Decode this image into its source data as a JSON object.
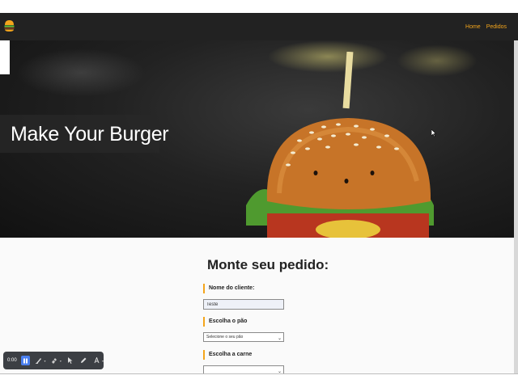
{
  "nav": {
    "links": [
      "Home",
      "Pedidos"
    ]
  },
  "hero": {
    "title": "Make Your Burger"
  },
  "form": {
    "title": "Monte seu pedido:",
    "name_label": "Nome do cliente:",
    "name_value": "Teste",
    "bread_label": "Escolha o pão",
    "bread_selected": "Selecione o seu pão",
    "meat_label": "Escolha a carne",
    "meat_selected": ""
  },
  "recorder": {
    "time": "0:00"
  },
  "colors": {
    "accent": "#f4a51c",
    "navbar": "#222222"
  }
}
